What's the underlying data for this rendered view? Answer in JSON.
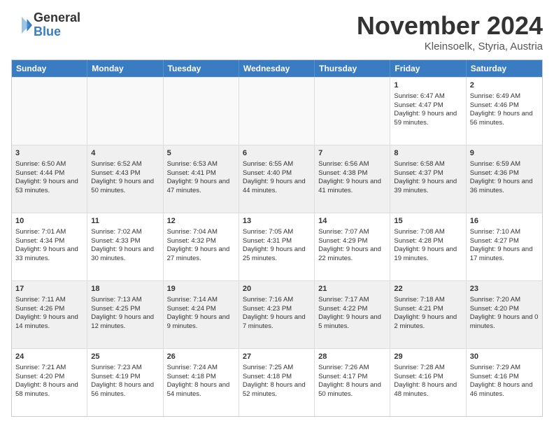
{
  "logo": {
    "general": "General",
    "blue": "Blue"
  },
  "header": {
    "month": "November 2024",
    "location": "Kleinsoelk, Styria, Austria"
  },
  "days": [
    "Sunday",
    "Monday",
    "Tuesday",
    "Wednesday",
    "Thursday",
    "Friday",
    "Saturday"
  ],
  "rows": [
    [
      {
        "day": "",
        "content": "",
        "empty": true
      },
      {
        "day": "",
        "content": "",
        "empty": true
      },
      {
        "day": "",
        "content": "",
        "empty": true
      },
      {
        "day": "",
        "content": "",
        "empty": true
      },
      {
        "day": "",
        "content": "",
        "empty": true
      },
      {
        "day": "1",
        "content": "Sunrise: 6:47 AM\nSunset: 4:47 PM\nDaylight: 9 hours and 59 minutes.",
        "empty": false
      },
      {
        "day": "2",
        "content": "Sunrise: 6:49 AM\nSunset: 4:46 PM\nDaylight: 9 hours and 56 minutes.",
        "empty": false
      }
    ],
    [
      {
        "day": "3",
        "content": "Sunrise: 6:50 AM\nSunset: 4:44 PM\nDaylight: 9 hours and 53 minutes.",
        "empty": false
      },
      {
        "day": "4",
        "content": "Sunrise: 6:52 AM\nSunset: 4:43 PM\nDaylight: 9 hours and 50 minutes.",
        "empty": false
      },
      {
        "day": "5",
        "content": "Sunrise: 6:53 AM\nSunset: 4:41 PM\nDaylight: 9 hours and 47 minutes.",
        "empty": false
      },
      {
        "day": "6",
        "content": "Sunrise: 6:55 AM\nSunset: 4:40 PM\nDaylight: 9 hours and 44 minutes.",
        "empty": false
      },
      {
        "day": "7",
        "content": "Sunrise: 6:56 AM\nSunset: 4:38 PM\nDaylight: 9 hours and 41 minutes.",
        "empty": false
      },
      {
        "day": "8",
        "content": "Sunrise: 6:58 AM\nSunset: 4:37 PM\nDaylight: 9 hours and 39 minutes.",
        "empty": false
      },
      {
        "day": "9",
        "content": "Sunrise: 6:59 AM\nSunset: 4:36 PM\nDaylight: 9 hours and 36 minutes.",
        "empty": false
      }
    ],
    [
      {
        "day": "10",
        "content": "Sunrise: 7:01 AM\nSunset: 4:34 PM\nDaylight: 9 hours and 33 minutes.",
        "empty": false
      },
      {
        "day": "11",
        "content": "Sunrise: 7:02 AM\nSunset: 4:33 PM\nDaylight: 9 hours and 30 minutes.",
        "empty": false
      },
      {
        "day": "12",
        "content": "Sunrise: 7:04 AM\nSunset: 4:32 PM\nDaylight: 9 hours and 27 minutes.",
        "empty": false
      },
      {
        "day": "13",
        "content": "Sunrise: 7:05 AM\nSunset: 4:31 PM\nDaylight: 9 hours and 25 minutes.",
        "empty": false
      },
      {
        "day": "14",
        "content": "Sunrise: 7:07 AM\nSunset: 4:29 PM\nDaylight: 9 hours and 22 minutes.",
        "empty": false
      },
      {
        "day": "15",
        "content": "Sunrise: 7:08 AM\nSunset: 4:28 PM\nDaylight: 9 hours and 19 minutes.",
        "empty": false
      },
      {
        "day": "16",
        "content": "Sunrise: 7:10 AM\nSunset: 4:27 PM\nDaylight: 9 hours and 17 minutes.",
        "empty": false
      }
    ],
    [
      {
        "day": "17",
        "content": "Sunrise: 7:11 AM\nSunset: 4:26 PM\nDaylight: 9 hours and 14 minutes.",
        "empty": false
      },
      {
        "day": "18",
        "content": "Sunrise: 7:13 AM\nSunset: 4:25 PM\nDaylight: 9 hours and 12 minutes.",
        "empty": false
      },
      {
        "day": "19",
        "content": "Sunrise: 7:14 AM\nSunset: 4:24 PM\nDaylight: 9 hours and 9 minutes.",
        "empty": false
      },
      {
        "day": "20",
        "content": "Sunrise: 7:16 AM\nSunset: 4:23 PM\nDaylight: 9 hours and 7 minutes.",
        "empty": false
      },
      {
        "day": "21",
        "content": "Sunrise: 7:17 AM\nSunset: 4:22 PM\nDaylight: 9 hours and 5 minutes.",
        "empty": false
      },
      {
        "day": "22",
        "content": "Sunrise: 7:18 AM\nSunset: 4:21 PM\nDaylight: 9 hours and 2 minutes.",
        "empty": false
      },
      {
        "day": "23",
        "content": "Sunrise: 7:20 AM\nSunset: 4:20 PM\nDaylight: 9 hours and 0 minutes.",
        "empty": false
      }
    ],
    [
      {
        "day": "24",
        "content": "Sunrise: 7:21 AM\nSunset: 4:20 PM\nDaylight: 8 hours and 58 minutes.",
        "empty": false
      },
      {
        "day": "25",
        "content": "Sunrise: 7:23 AM\nSunset: 4:19 PM\nDaylight: 8 hours and 56 minutes.",
        "empty": false
      },
      {
        "day": "26",
        "content": "Sunrise: 7:24 AM\nSunset: 4:18 PM\nDaylight: 8 hours and 54 minutes.",
        "empty": false
      },
      {
        "day": "27",
        "content": "Sunrise: 7:25 AM\nSunset: 4:18 PM\nDaylight: 8 hours and 52 minutes.",
        "empty": false
      },
      {
        "day": "28",
        "content": "Sunrise: 7:26 AM\nSunset: 4:17 PM\nDaylight: 8 hours and 50 minutes.",
        "empty": false
      },
      {
        "day": "29",
        "content": "Sunrise: 7:28 AM\nSunset: 4:16 PM\nDaylight: 8 hours and 48 minutes.",
        "empty": false
      },
      {
        "day": "30",
        "content": "Sunrise: 7:29 AM\nSunset: 4:16 PM\nDaylight: 8 hours and 46 minutes.",
        "empty": false
      }
    ]
  ]
}
